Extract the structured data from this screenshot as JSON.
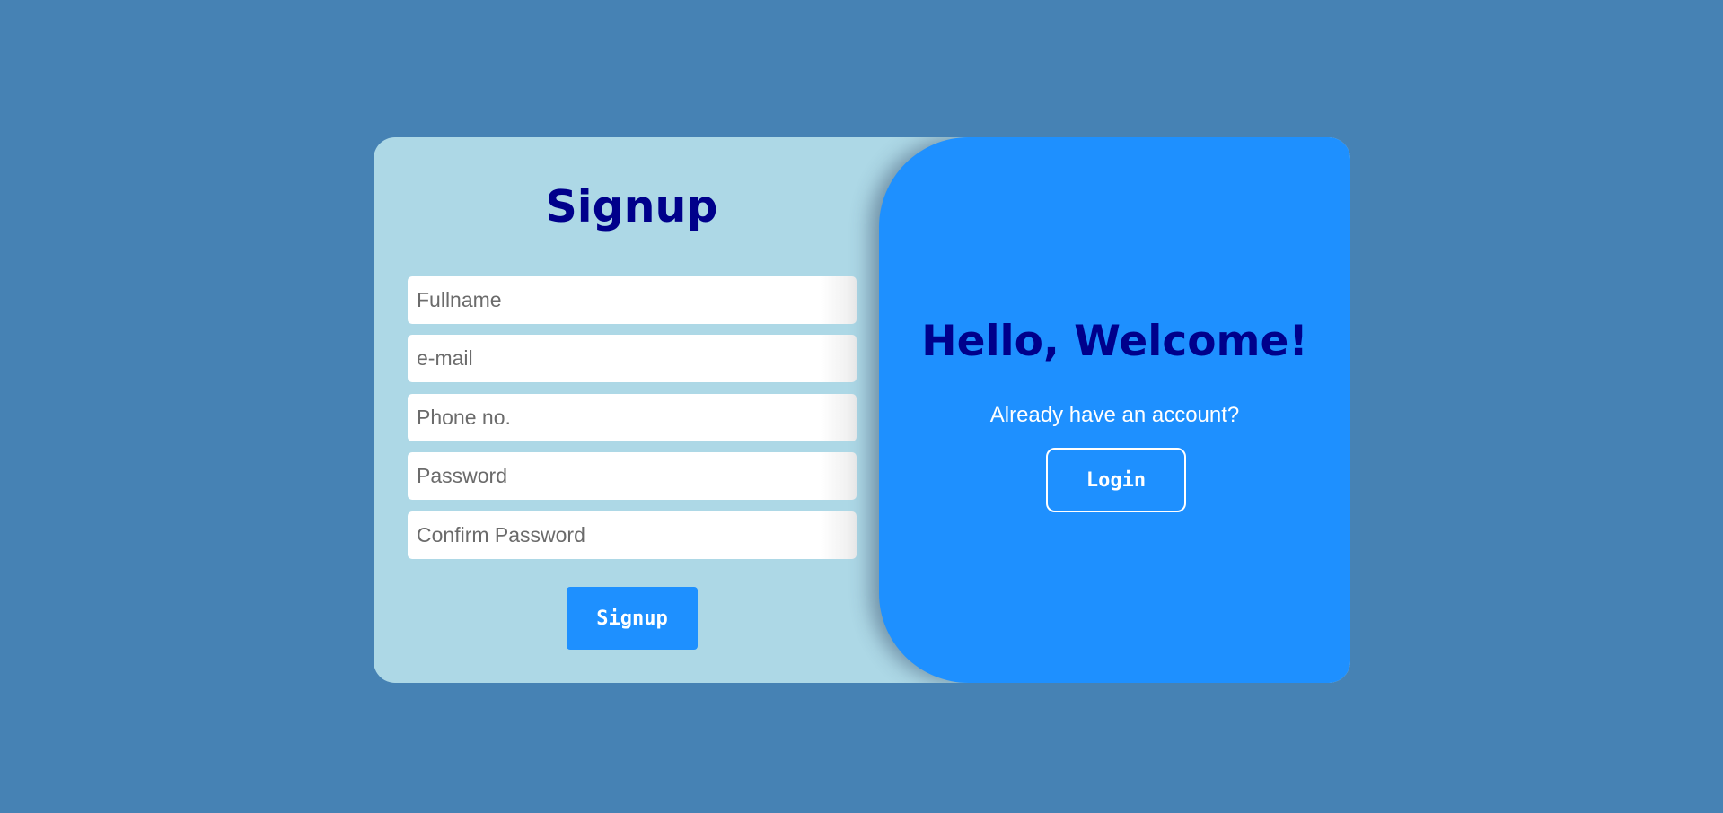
{
  "signup": {
    "title": "Signup",
    "fields": [
      {
        "placeholder": "Fullname",
        "value": ""
      },
      {
        "placeholder": "e-mail",
        "value": ""
      },
      {
        "placeholder": "Phone no.",
        "value": ""
      },
      {
        "placeholder": "Password",
        "value": ""
      },
      {
        "placeholder": "Confirm Password",
        "value": ""
      }
    ],
    "submit_label": "Signup"
  },
  "welcome": {
    "title": "Hello, Welcome!",
    "prompt": "Already have an account?",
    "login_label": "Login"
  },
  "colors": {
    "page_background": "#4682b4",
    "card_background": "#add8e6",
    "accent": "#1e90ff",
    "heading": "#00008b",
    "button_text": "#ffffff"
  }
}
